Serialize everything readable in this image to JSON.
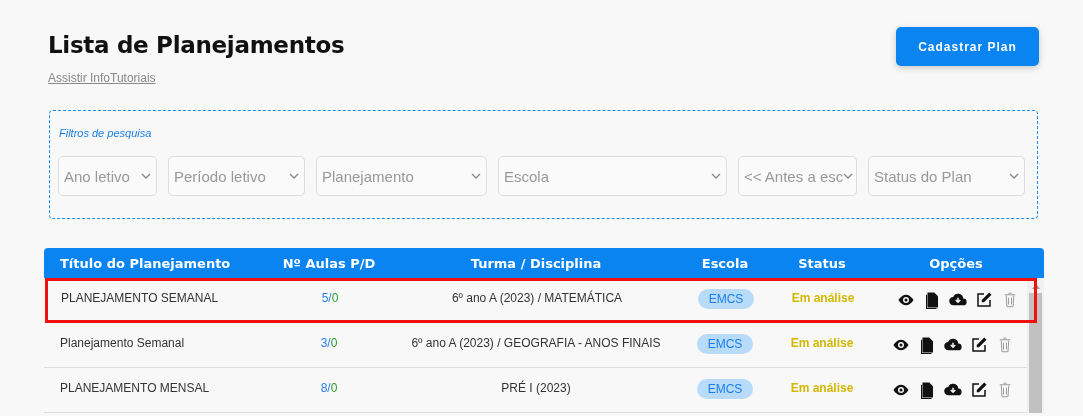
{
  "page": {
    "title": "Lista de Planejamentos",
    "tutorial_link": "Assistir InfoTutoriais",
    "create_button": "Cadastrar Plan"
  },
  "filters": {
    "legend": "Filtros de pesquisa",
    "selects": [
      {
        "placeholder": "Ano letivo"
      },
      {
        "placeholder": "Período letivo"
      },
      {
        "placeholder": "Planejamento"
      },
      {
        "placeholder": "Escola"
      },
      {
        "placeholder": "<< Antes a esc"
      },
      {
        "placeholder": "Status do Plan"
      }
    ]
  },
  "table": {
    "columns": [
      "Título do Planejamento",
      "Nº Aulas P/D",
      "Turma / Disciplina",
      "Escola",
      "Status",
      "Opções"
    ],
    "rows": [
      {
        "title": "PLANEJAMENTO SEMANAL",
        "lessons_planned": "5/",
        "lessons_done": "0",
        "class_subject": "6º ano A (2023) / MATEMÁTICA",
        "school": "EMCS",
        "status": "Em análise",
        "highlighted": true
      },
      {
        "title": "Planejamento Semanal",
        "lessons_planned": "3/",
        "lessons_done": "0",
        "class_subject": "6º ano A (2023) / GEOGRAFIA - ANOS FINAIS",
        "school": "EMCS",
        "status": "Em análise",
        "highlighted": false
      },
      {
        "title": "PLANEJAMENTO MENSAL",
        "lessons_planned": "8/",
        "lessons_done": "0",
        "class_subject": "PRÉ I (2023)",
        "school": "EMCS",
        "status": "Em análise",
        "highlighted": false
      }
    ]
  }
}
